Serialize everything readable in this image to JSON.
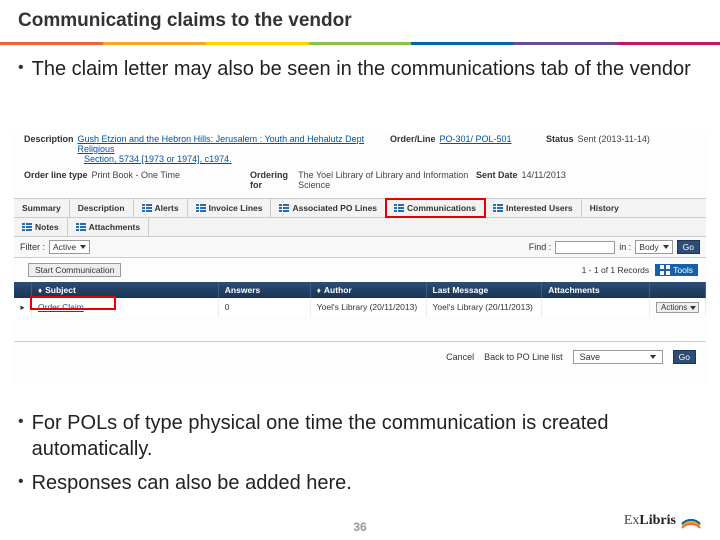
{
  "title": "Communicating claims to the vendor",
  "bullets_top": [
    "The claim letter may also be seen in the communications tab of the vendor"
  ],
  "bullets_bottom": [
    "For POLs of type physical one time the communication is created automatically.",
    "Responses can also be added here."
  ],
  "screenshot": {
    "desc_lbl": "Description",
    "desc_val1": "Gush Etzion and the Hebron Hills: Jerusalem : Youth and Hehalutz Dept Religious",
    "desc_val2": "Section, 5734 [1973 or 1974], c1974.",
    "orderline_lbl": "Order/Line",
    "orderline_val": "PO-301/ POL-501",
    "status_lbl": "Status",
    "status_val": "Sent (2013-11-14)",
    "ordtype_lbl": "Order line type",
    "ordtype_val": "Print Book - One Time",
    "ordfor_lbl": "Ordering for",
    "ordfor_val": "The Yoel Library of Library and Information Science",
    "sent_lbl": "Sent Date",
    "sent_val": "14/11/2013",
    "tabs": {
      "summary": "Summary",
      "description": "Description",
      "alerts": "Alerts",
      "invoice": "Invoice Lines",
      "assoc": "Associated PO Lines",
      "comm": "Communications",
      "interested": "Interested Users",
      "history": "History",
      "notes": "Notes",
      "attach": "Attachments"
    },
    "filter_lbl": "Filter :",
    "filter_val": "Active",
    "find_lbl": "Find :",
    "in_lbl": "in :",
    "in_val": "Body",
    "go": "Go",
    "records": "1 - 1 of 1 Records",
    "tools": "Tools",
    "start_comm": "Start Communication",
    "thead": {
      "subject": "Subject",
      "answers": "Answers",
      "author": "Author",
      "last": "Last Message",
      "attach": "Attachments"
    },
    "row": {
      "subject": "Order Claim",
      "answers": "0",
      "author": "Yoel's Library (20/11/2013)",
      "last": "Yoel's Library (20/11/2013)",
      "attach": "",
      "actions": "Actions"
    },
    "footer": {
      "cancel": "Cancel",
      "back": "Back to PO Line list",
      "save": "Save",
      "go": "Go"
    }
  },
  "page_number": "36",
  "logo": {
    "ex": "Ex",
    "libris": "Libris"
  }
}
